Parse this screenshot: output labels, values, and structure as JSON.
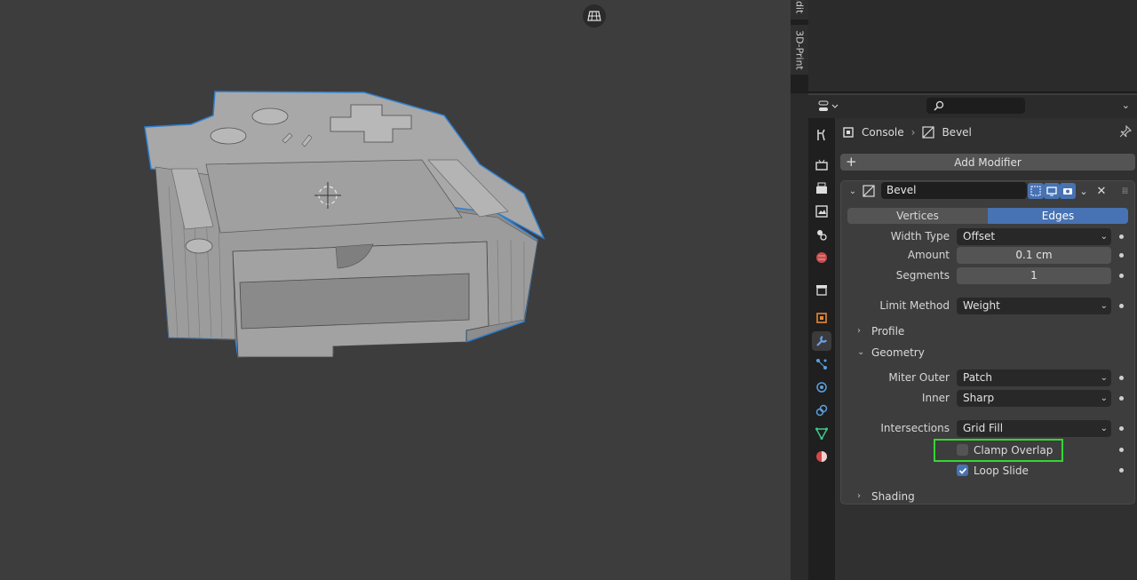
{
  "viewport": {
    "view_toggle_icon": "grid-view-icon",
    "model_description_icon": "bevel-mesh-object"
  },
  "sidebar_tabs": [
    {
      "label": "Edit"
    },
    {
      "label": "3D-Print"
    }
  ],
  "properties_header": {
    "editor_icon": "properties-editor-icon",
    "search_placeholder": ""
  },
  "prop_tabs": [
    {
      "name": "tool",
      "icon": "tool-icon"
    },
    {
      "name": "render",
      "icon": "render-icon"
    },
    {
      "name": "output",
      "icon": "output-icon"
    },
    {
      "name": "view-layer",
      "icon": "view-layer-icon"
    },
    {
      "name": "scene",
      "icon": "scene-icon"
    },
    {
      "name": "world",
      "icon": "world-icon"
    },
    {
      "name": "collection",
      "icon": "collection-icon"
    },
    {
      "name": "object",
      "icon": "object-icon"
    },
    {
      "name": "modifiers",
      "icon": "wrench-icon",
      "active": true
    },
    {
      "name": "particles",
      "icon": "particles-icon"
    },
    {
      "name": "physics",
      "icon": "physics-icon"
    },
    {
      "name": "constraints",
      "icon": "constraints-icon"
    },
    {
      "name": "data",
      "icon": "mesh-data-icon"
    },
    {
      "name": "material",
      "icon": "material-icon"
    }
  ],
  "breadcrumb": {
    "object": "Console",
    "modifier": "Bevel"
  },
  "add_modifier_label": "Add Modifier",
  "modifier": {
    "name": "Bevel",
    "affect_options": [
      "Vertices",
      "Edges"
    ],
    "affect_selected": "Edges",
    "width_type_label": "Width Type",
    "width_type_value": "Offset",
    "amount_label": "Amount",
    "amount_value": "0.1 cm",
    "segments_label": "Segments",
    "segments_value": "1",
    "limit_method_label": "Limit Method",
    "limit_method_value": "Weight",
    "profile_label": "Profile",
    "geometry_label": "Geometry",
    "miter_outer_label": "Miter Outer",
    "miter_outer_value": "Patch",
    "inner_label": "Inner",
    "inner_value": "Sharp",
    "intersections_label": "Intersections",
    "intersections_value": "Grid Fill",
    "clamp_overlap_label": "Clamp Overlap",
    "clamp_overlap_checked": false,
    "loop_slide_label": "Loop Slide",
    "loop_slide_checked": true,
    "shading_label": "Shading"
  },
  "colors": {
    "accent": "#4772b3",
    "highlight": "#35d635",
    "selection_outline": "#4a90d9"
  }
}
